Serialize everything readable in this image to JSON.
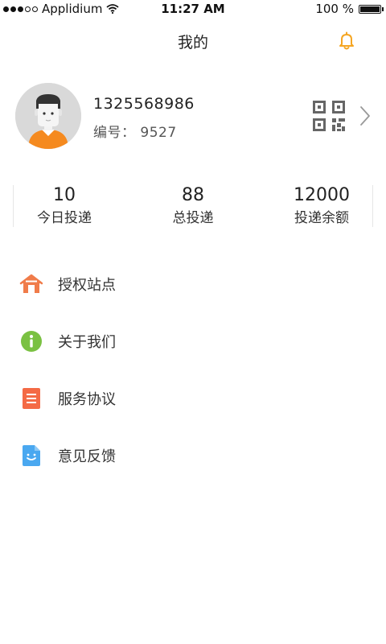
{
  "status_bar": {
    "carrier": "Applidium",
    "time": "11:27 AM",
    "battery": "100 %"
  },
  "nav": {
    "title": "我的",
    "notification_icon": "bell-icon",
    "accent_color": "#f5a623"
  },
  "profile": {
    "phone": "1325568986",
    "id_label": "编号：",
    "id_value": "9527",
    "id_text": "编号： 9527",
    "avatar_icon": "user-avatar-icon",
    "qr_icon": "qr-code-icon",
    "arrow_icon": "chevron-right-icon"
  },
  "stats": [
    {
      "value": "10",
      "label": "今日投递"
    },
    {
      "value": "88",
      "label": "总投递"
    },
    {
      "value": "12000",
      "label": "投递余额"
    }
  ],
  "menu": [
    {
      "label": "授权站点",
      "icon": "home-icon",
      "color": "#f07c4a"
    },
    {
      "label": "关于我们",
      "icon": "info-icon",
      "color": "#7ac142"
    },
    {
      "label": "服务协议",
      "icon": "document-icon",
      "color": "#f46a45"
    },
    {
      "label": "意见反馈",
      "icon": "feedback-icon",
      "color": "#4aa8f0"
    }
  ]
}
